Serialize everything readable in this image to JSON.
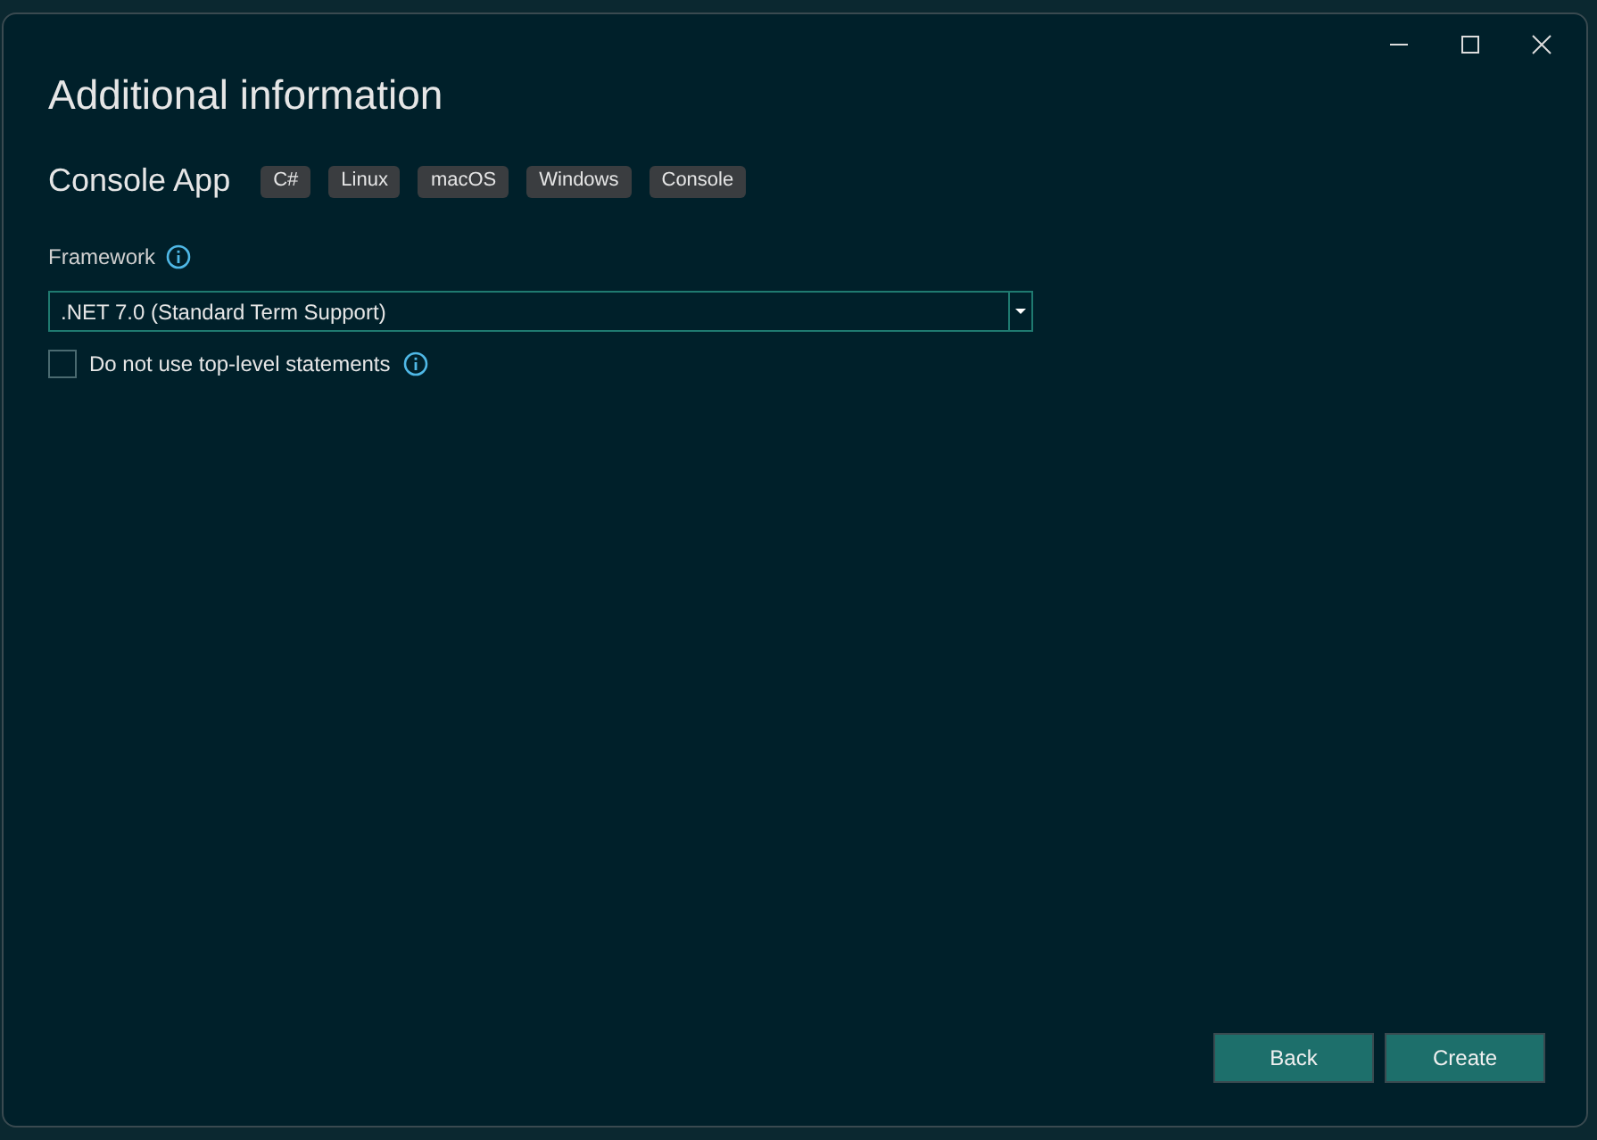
{
  "window": {
    "title": "Additional information"
  },
  "project": {
    "name": "Console App",
    "tags": [
      "C#",
      "Linux",
      "macOS",
      "Windows",
      "Console"
    ]
  },
  "framework": {
    "label": "Framework",
    "value": ".NET 7.0 (Standard Term Support)"
  },
  "options": [
    {
      "label": "Do not use top-level statements",
      "checked": false
    }
  ],
  "buttons": [
    "Back",
    "Create"
  ]
}
